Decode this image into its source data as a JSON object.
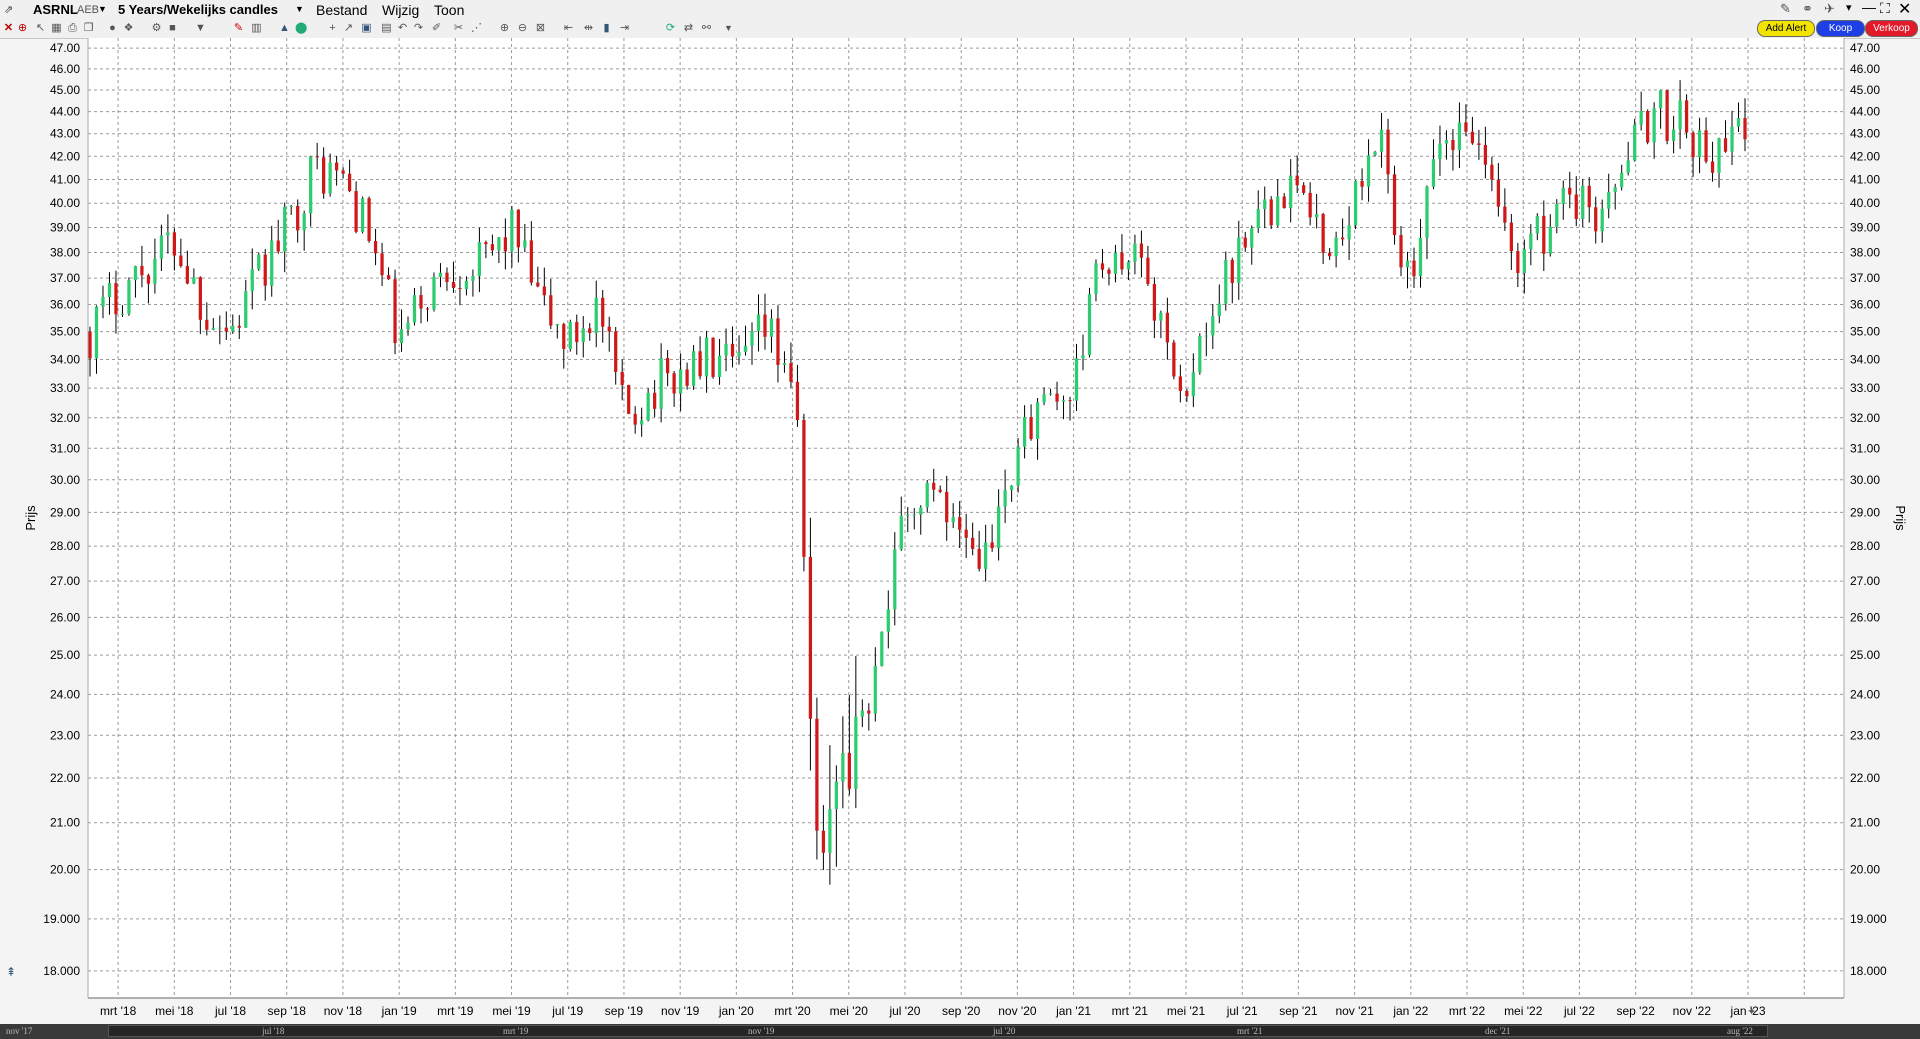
{
  "window": {
    "symbol": "ASRNL",
    "exchange": "AEB",
    "period": "5 Years/Wekelijks candles",
    "menu": [
      "Bestand",
      "Wijzig",
      "Toon"
    ]
  },
  "toolbar": {
    "add_alert": "Add Alert",
    "buy": "Koop",
    "sell": "Verkoop"
  },
  "colors": {
    "up": "#2ecc71",
    "down": "#d11818",
    "wick": "#000000",
    "grid": "#9a9a9a",
    "background": "#ffffff"
  },
  "chart_data": {
    "type": "candlestick",
    "title": "",
    "ylabel": "Prijs",
    "ylabel_right": "Prijs",
    "y_scale": "log",
    "ylim": [
      17.5,
      47.5
    ],
    "y_ticks": [
      "47.00",
      "46.00",
      "45.00",
      "44.00",
      "43.00",
      "42.00",
      "41.00",
      "40.00",
      "39.00",
      "38.00",
      "37.00",
      "36.00",
      "35.00",
      "34.00",
      "33.00",
      "32.00",
      "31.00",
      "30.00",
      "29.00",
      "28.00",
      "27.00",
      "26.00",
      "25.00",
      "24.00",
      "23.00",
      "22.00",
      "21.00",
      "20.00",
      "19.000",
      "18.000"
    ],
    "x_ticks": [
      "mrt '18",
      "mei '18",
      "jul '18",
      "sep '18",
      "nov '18",
      "jan '19",
      "mrt '19",
      "mei '19",
      "jul '19",
      "sep '19",
      "nov '19",
      "jan '20",
      "mrt '20",
      "mei '20",
      "jul '20",
      "sep '20",
      "nov '20",
      "jan '21",
      "mrt '21",
      "mei '21",
      "jul '21",
      "sep '21",
      "nov '21",
      "jan '22",
      "mrt '22",
      "mei '22",
      "jul '22",
      "sep '22",
      "nov '22",
      "jan '23"
    ],
    "overview_ticks": [
      "nov '17",
      "jul '18",
      "mrt '19",
      "nov '19",
      "jul '20",
      "mrt '21",
      "dec '21",
      "aug '22"
    ],
    "grid": true,
    "weeks_per_month": 4.33,
    "monthly_anchors": [
      35.0,
      36.5,
      37.5,
      38.5,
      36.0,
      35.0,
      37.0,
      39.0,
      41.5,
      41.0,
      38.5,
      34.5,
      36.5,
      37.5,
      37.5,
      39.0,
      36.0,
      34.5,
      36.0,
      32.0,
      33.0,
      33.5,
      34.0,
      33.5,
      35.0,
      33.5,
      19.5,
      22.5,
      24.5,
      29.0,
      29.5,
      29.0,
      27.5,
      31.0,
      33.0,
      33.0,
      37.5,
      38.5,
      35.0,
      33.0,
      35.5,
      38.5,
      39.5,
      40.5,
      38.0,
      40.5,
      42.5,
      36.0,
      43.0,
      42.5,
      40.0,
      37.5,
      39.5,
      40.5,
      39.5,
      43.0,
      44.0,
      43.0,
      42.0,
      43.0
    ]
  }
}
